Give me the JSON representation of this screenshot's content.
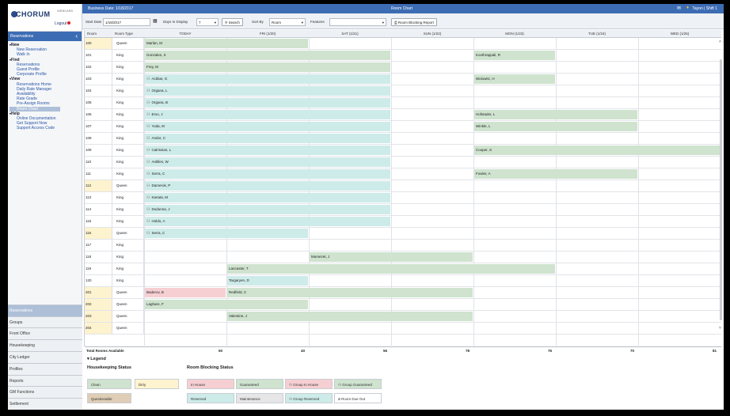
{
  "sidebar": {
    "logo": "CHORUM",
    "logo_tag": "WEBCARD",
    "logout": "Logout",
    "section": "Reservations",
    "menu": [
      {
        "type": "grp",
        "label": "New"
      },
      {
        "type": "itm",
        "label": "New Reservation"
      },
      {
        "type": "itm",
        "label": "Walk In"
      },
      {
        "type": "grp",
        "label": "Find"
      },
      {
        "type": "itm",
        "label": "Reservations"
      },
      {
        "type": "itm",
        "label": "Guest Profile"
      },
      {
        "type": "itm",
        "label": "Corporate Profile"
      },
      {
        "type": "grp",
        "label": "View"
      },
      {
        "type": "itm",
        "label": "Reservations Home"
      },
      {
        "type": "itm",
        "label": "Daily Rate Manager"
      },
      {
        "type": "itm",
        "label": "Availability"
      },
      {
        "type": "itm",
        "label": "Rate Grade"
      },
      {
        "type": "itm",
        "label": "Pre-Assign Rooms"
      },
      {
        "type": "itm",
        "label": "Room Chart",
        "active": true
      },
      {
        "type": "grp",
        "label": "Help"
      },
      {
        "type": "itm",
        "label": "Online Documentation"
      },
      {
        "type": "itm",
        "label": "Get Support Now"
      },
      {
        "type": "itm",
        "label": "Support Access Code"
      }
    ],
    "nav": [
      "Reservations",
      "Groups",
      "Front Office",
      "Housekeeping",
      "City Ledger",
      "Profiles",
      "Reports",
      "GM Functions",
      "Settlement"
    ]
  },
  "topbar": {
    "business_date": "Business Date: 1/18/2017",
    "title": "Room Chart",
    "user": "Tayon | Shift 1"
  },
  "toolbar": {
    "start_date_label": "Start Date",
    "start_date_value": "1/18/2017",
    "days_label": "Days In Display",
    "days_value": "7",
    "search_label": "Search",
    "sort_label": "Sort By",
    "sort_value": "Room",
    "features_label": "Features",
    "report_label": "Room Blocking Report"
  },
  "grid": {
    "headers": [
      "Room",
      "Room Type",
      "TODAY",
      "FRI (1/20)",
      "SAT (1/21)",
      "SUN (1/22)",
      "MON (1/23)",
      "TUE (1/24)",
      "WED (1/25)"
    ],
    "rows": [
      {
        "room": "100",
        "type": "Queen"
      },
      {
        "room": "101",
        "type": "King"
      },
      {
        "room": "102",
        "type": "King"
      },
      {
        "room": "103",
        "type": "King"
      },
      {
        "room": "104",
        "type": "King"
      },
      {
        "room": "105",
        "type": "King"
      },
      {
        "room": "106",
        "type": "King"
      },
      {
        "room": "107",
        "type": "King"
      },
      {
        "room": "108",
        "type": "King"
      },
      {
        "room": "109",
        "type": "King"
      },
      {
        "room": "110",
        "type": "King"
      },
      {
        "room": "111",
        "type": "King"
      },
      {
        "room": "112",
        "type": "Queen"
      },
      {
        "room": "113",
        "type": "King"
      },
      {
        "room": "114",
        "type": "King"
      },
      {
        "room": "115",
        "type": "King"
      },
      {
        "room": "116",
        "type": "Queen"
      },
      {
        "room": "117",
        "type": "King"
      },
      {
        "room": "118",
        "type": "King"
      },
      {
        "room": "119",
        "type": "King"
      },
      {
        "room": "120",
        "type": "King"
      },
      {
        "room": "201",
        "type": "Queen"
      },
      {
        "room": "202",
        "type": "Queen"
      },
      {
        "room": "203",
        "type": "Queen"
      },
      {
        "room": "204",
        "type": "Queen"
      }
    ],
    "total_label": "Total Rooms Available",
    "totals": [
      "50",
      "40",
      "56",
      "78",
      "76",
      "70",
      "81"
    ]
  },
  "reservations": [
    {
      "row": 0,
      "name": "Marlan, M",
      "start": 0,
      "end": 2,
      "color": "g",
      "group": false
    },
    {
      "row": 1,
      "name": "Gonzales, S",
      "start": 0,
      "end": 3,
      "color": "g",
      "group": false
    },
    {
      "row": 1,
      "name": "Koothrappali, R",
      "start": 4,
      "end": 5,
      "color": "g",
      "group": false
    },
    {
      "row": 2,
      "name": "Frey, M",
      "start": 0,
      "end": 3,
      "color": "g",
      "group": false
    },
    {
      "row": 3,
      "name": "Ackbar, G",
      "start": 0,
      "end": 3,
      "color": "t",
      "group": true
    },
    {
      "row": 3,
      "name": "Wolowitz, H",
      "start": 4,
      "end": 5,
      "color": "g",
      "group": false
    },
    {
      "row": 4,
      "name": "Organa, L",
      "start": 0,
      "end": 3,
      "color": "t",
      "group": true
    },
    {
      "row": 5,
      "name": "Organa, B",
      "start": 0,
      "end": 3,
      "color": "t",
      "group": true
    },
    {
      "row": 6,
      "name": "Erso, J",
      "start": 0,
      "end": 3,
      "color": "t",
      "group": true
    },
    {
      "row": 6,
      "name": "Hofstader, L",
      "start": 4,
      "end": 6,
      "color": "g",
      "group": false
    },
    {
      "row": 7,
      "name": "Yoda, M",
      "start": 0,
      "end": 3,
      "color": "t",
      "group": true
    },
    {
      "row": 7,
      "name": "Winkle, L",
      "start": 4,
      "end": 6,
      "color": "g",
      "group": false
    },
    {
      "row": 8,
      "name": "Andor, C",
      "start": 0,
      "end": 3,
      "color": "t",
      "group": true
    },
    {
      "row": 9,
      "name": "Calrissian, L",
      "start": 0,
      "end": 3,
      "color": "t",
      "group": true
    },
    {
      "row": 9,
      "name": "Cooper, S",
      "start": 4,
      "end": 7,
      "color": "g",
      "group": false
    },
    {
      "row": 10,
      "name": "Antilles, W",
      "start": 0,
      "end": 3,
      "color": "t",
      "group": true
    },
    {
      "row": 11,
      "name": "Serra, C",
      "start": 0,
      "end": 3,
      "color": "t",
      "group": true
    },
    {
      "row": 11,
      "name": "Fowler, A",
      "start": 4,
      "end": 6,
      "color": "g",
      "group": false
    },
    {
      "row": 12,
      "name": "Damerok, P",
      "start": 0,
      "end": 3,
      "color": "t",
      "group": true
    },
    {
      "row": 13,
      "name": "Kanata, M",
      "start": 0,
      "end": 3,
      "color": "t",
      "group": true
    },
    {
      "row": 14,
      "name": "Dodonna, J",
      "start": 0,
      "end": 3,
      "color": "t",
      "group": true
    },
    {
      "row": 15,
      "name": "Holdo, A",
      "start": 0,
      "end": 3,
      "color": "t",
      "group": true
    },
    {
      "row": 16,
      "name": "Serra, C",
      "start": 0,
      "end": 2,
      "color": "t",
      "group": true
    },
    {
      "row": 18,
      "name": "Mumezet, J",
      "start": 2,
      "end": 4,
      "color": "g",
      "group": false
    },
    {
      "row": 19,
      "name": "Lancaster, T",
      "start": 1,
      "end": 5,
      "color": "g",
      "group": false
    },
    {
      "row": 20,
      "name": "Targaryen, D",
      "start": 1,
      "end": 2,
      "color": "t",
      "group": false
    },
    {
      "row": 21,
      "name": "Baderov, B",
      "start": 0,
      "end": 1,
      "color": "p",
      "group": false
    },
    {
      "row": 21,
      "name": "Redfield, C",
      "start": 1,
      "end": 4,
      "color": "g",
      "group": false
    },
    {
      "row": 22,
      "name": "Laghare, F",
      "start": 0,
      "end": 2,
      "color": "g",
      "group": false
    },
    {
      "row": 23,
      "name": "Valentine, J",
      "start": 1,
      "end": 4,
      "color": "g",
      "group": false
    }
  ],
  "legend": {
    "title": "Legend",
    "hk_title": "Housekeeping Status",
    "rb_title": "Room Blocking Status",
    "hk": [
      {
        "label": "Clean",
        "color": "#cfe3cf"
      },
      {
        "label": "Dirty",
        "color": "#fdf3cf"
      },
      {
        "label": "Questionable",
        "color": "#dfcdb5"
      }
    ],
    "rb": [
      {
        "label": "In House",
        "color": "#f6cfd3",
        "group": false
      },
      {
        "label": "Guaranteed",
        "color": "#cfe3cf",
        "group": false
      },
      {
        "label": "Group In House",
        "color": "#f6cfd3",
        "group": true
      },
      {
        "label": "Group Guaranteed",
        "color": "#cfe3cf",
        "group": true
      },
      {
        "label": "Reserved",
        "color": "#cdebe9",
        "group": false
      },
      {
        "label": "Maintenance",
        "color": "#e6e6e6",
        "group": false
      },
      {
        "label": "Group Reserved",
        "color": "#cdebe9",
        "group": true
      },
      {
        "label": "Room Due Out",
        "color": "#ffffff",
        "group": false
      }
    ]
  }
}
